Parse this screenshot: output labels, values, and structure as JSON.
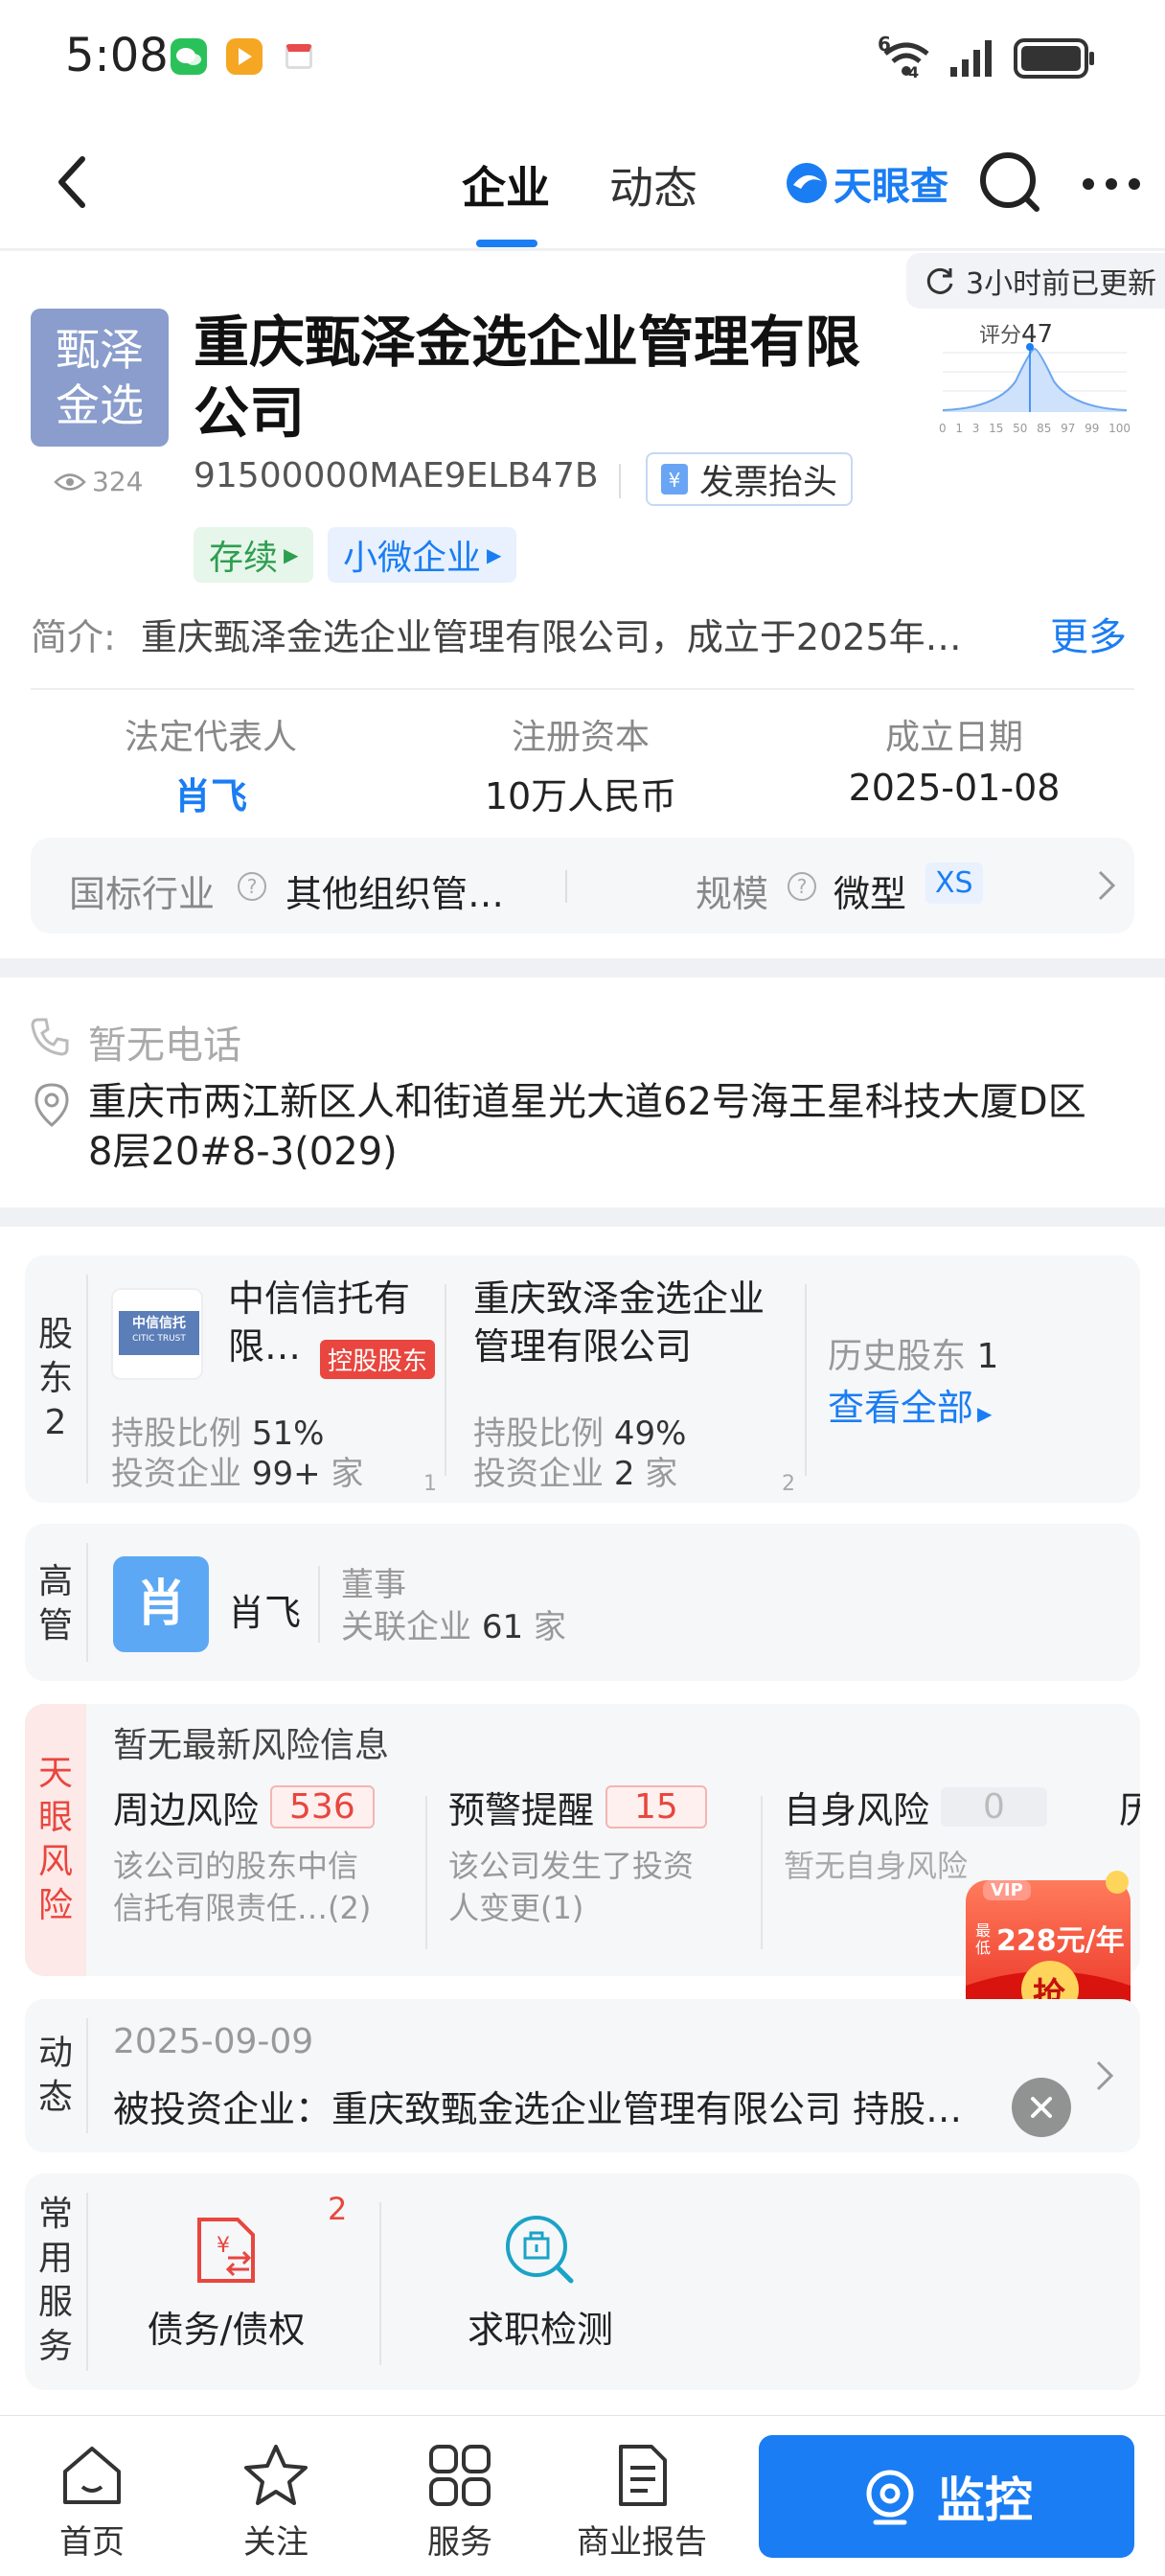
{
  "status_bar": {
    "time": "5:08",
    "network": "6",
    "network_sub": "4"
  },
  "nav": {
    "tabs": [
      "企业",
      "动态"
    ],
    "brand": "天眼查"
  },
  "update_badge": "3小时前已更新",
  "company": {
    "logo_text": [
      "甄泽",
      "金选"
    ],
    "name_line1": "重庆甄泽金选企业管理有限",
    "name_line2": "公司",
    "views": "324",
    "credit_code": "91500000MAE9ELB47B",
    "invoice_label": "发票抬头",
    "tags": [
      "存续",
      "小微企业"
    ],
    "intro_label": "简介:",
    "intro_text": "重庆甄泽金选企业管理有限公司，成立于2025年…",
    "more_label": "更多",
    "score_label": "评分",
    "score": "47",
    "score_axis": [
      "0",
      "1",
      "3",
      "15",
      "50",
      "85",
      "97",
      "99",
      "100"
    ]
  },
  "basic_info": {
    "legal_rep_label": "法定代表人",
    "legal_rep": "肖飞",
    "capital_label": "注册资本",
    "capital": "10万人民币",
    "date_label": "成立日期",
    "date": "2025-01-08"
  },
  "industry": {
    "industry_label": "国标行业",
    "industry_value": "其他组织管…",
    "scale_label": "规模",
    "scale_value": "微型",
    "scale_tag": "XS"
  },
  "contact": {
    "phone": "暂无电话",
    "address_line1": "重庆市两江新区人和街道星光大道62号海王星科技大厦D区",
    "address_line2": "8层20#8-3(029)"
  },
  "shareholders": {
    "section_label": [
      "股",
      "东",
      "2"
    ],
    "items": [
      {
        "name_line1": "中信信托有",
        "name_line2": "限…",
        "tag": "控股股东",
        "ratio_label": "持股比例",
        "ratio": "51%",
        "invest_label": "投资企业",
        "invest": "99+",
        "unit": "家",
        "index": "1",
        "logo_text": "中信信托",
        "logo_sub": "CITIC TRUST"
      },
      {
        "name_line1": "重庆致泽金选企业",
        "name_line2": "管理有限公司",
        "ratio_label": "持股比例",
        "ratio": "49%",
        "invest_label": "投资企业",
        "invest": "2",
        "unit": "家",
        "index": "2"
      }
    ],
    "history_label": "历史股东",
    "history_count": "1",
    "view_all": "查看全部"
  },
  "executives": {
    "section_label": [
      "高",
      "管"
    ],
    "avatar_char": "肖",
    "name": "肖飞",
    "role": "董事",
    "related_label": "关联企业",
    "related_count": "61",
    "unit": "家"
  },
  "risk": {
    "section_label": [
      "天",
      "眼",
      "风",
      "险"
    ],
    "headline": "暂无最新风险信息",
    "items": [
      {
        "label": "周边风险",
        "count": "536",
        "desc_line1": "该公司的股东中信",
        "desc_line2": "信托有限责任…(2)"
      },
      {
        "label": "预警提醒",
        "count": "15",
        "desc_line1": "该公司发生了投资",
        "desc_line2": "人变更(1)"
      },
      {
        "label": "自身风险",
        "count": "0",
        "desc_line1": "暂无自身风险",
        "desc_line2": ""
      }
    ],
    "cut_label": "历"
  },
  "promo": {
    "vip": "VIP",
    "price_prefix": "最低",
    "price": "228元/年",
    "action": "抢"
  },
  "news": {
    "section_label": [
      "动",
      "态"
    ],
    "date": "2025-09-09",
    "text": "被投资企业：重庆致甄金选企业管理有限公司 持股…"
  },
  "services": {
    "section_label": [
      "常",
      "用",
      "服",
      "务"
    ],
    "items": [
      {
        "label": "债务/债权",
        "badge": "2"
      },
      {
        "label": "求职检测"
      }
    ]
  },
  "bottom_nav": {
    "items": [
      "首页",
      "关注",
      "服务",
      "商业报告"
    ],
    "monitor": "监控"
  },
  "colors": {
    "accent": "#1a7df3",
    "risk_red": "#e8463e",
    "tag_green": "#2e9e4f"
  }
}
